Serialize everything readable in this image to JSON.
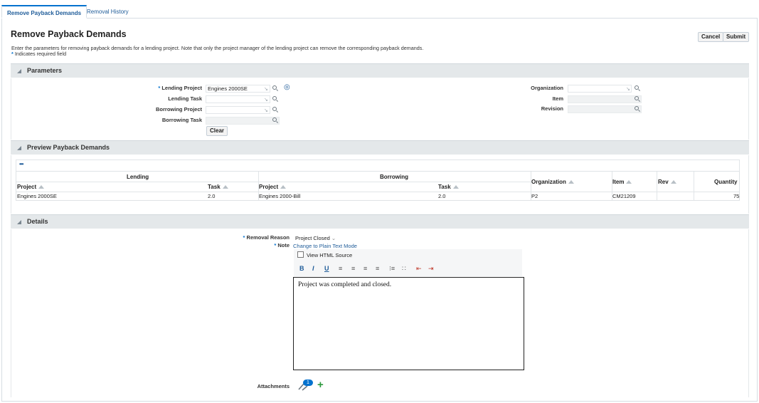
{
  "tabs": [
    {
      "label": "Remove Payback Demands",
      "active": true
    },
    {
      "label": "Removal History",
      "active": false
    }
  ],
  "page": {
    "title": "Remove Payback Demands",
    "intro": "Enter the parameters for removing payback demands for a lending project. Note that only the project manager of the lending project can remove the corresponding payback demands.",
    "required_note": "Indicates required field",
    "required_marker": "*",
    "cancel_label": "Cancel",
    "submit_label": "Submit"
  },
  "parameters": {
    "section_title": "Parameters",
    "lending_project_label": "Lending Project",
    "lending_project_value": "Engines 2000SE",
    "lending_task_label": "Lending Task",
    "borrowing_project_label": "Borrowing Project",
    "borrowing_task_label": "Borrowing Task",
    "clear_label": "Clear",
    "organization_label": "Organization",
    "item_label": "Item",
    "revision_label": "Revision"
  },
  "preview": {
    "section_title": "Preview Payback Demands",
    "more_label": "•••",
    "group_lending": "Lending",
    "group_borrowing": "Borrowing",
    "columns": {
      "lending_project": "Project",
      "lending_task": "Task",
      "borrowing_project": "Project",
      "borrowing_task": "Task",
      "organization": "Organization",
      "item": "Item",
      "rev": "Rev",
      "quantity": "Quantity"
    },
    "rows": [
      {
        "lending_project": "Engines 2000SE",
        "lending_task": "2.0",
        "borrowing_project": "Engines 2000-Bill",
        "borrowing_task": "2.0",
        "organization": "P2",
        "item": "CM21209",
        "rev": "",
        "quantity": "75"
      }
    ]
  },
  "details": {
    "section_title": "Details",
    "removal_reason_label": "Removal Reason",
    "removal_reason_value": "Project Closed",
    "note_label": "Note",
    "plain_text_link": "Change to Plain Text Mode",
    "view_html_label": "View HTML Source",
    "note_text": "Project was completed and closed.",
    "attachments_label": "Attachments",
    "attachments_count": "1"
  },
  "colors": {
    "accent": "#0572ce",
    "link": "#1f5c99",
    "section_bg": "#e4e8ea",
    "add_green": "#2e9a3e"
  }
}
